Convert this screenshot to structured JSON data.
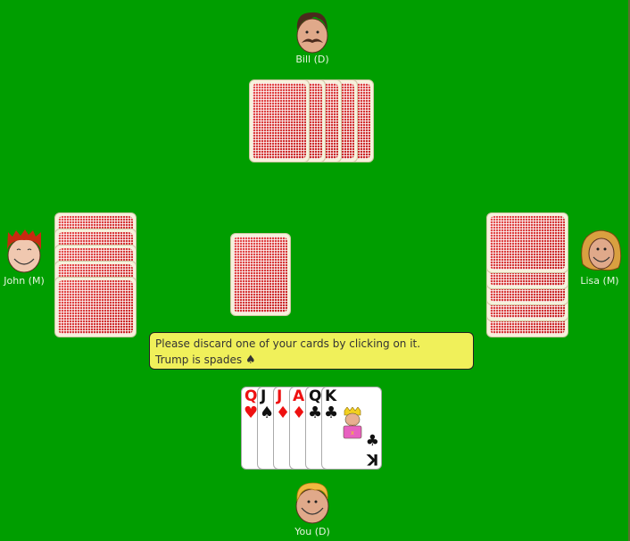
{
  "game": {
    "message_line1": "Please discard one of your cards by clicking on it.",
    "message_line2": "Trump is spades",
    "trump_suit_icon": "♠",
    "trump_suit": "spades"
  },
  "players": {
    "top": {
      "name": "Bill (D)",
      "card_count": 5
    },
    "left": {
      "name": "John (M)",
      "card_count": 5
    },
    "right": {
      "name": "Lisa (M)",
      "card_count": 5
    },
    "bottom": {
      "name": "You (D)",
      "card_count": 6
    }
  },
  "center": {
    "face_down_cards": 1
  },
  "hand": [
    {
      "rank": "Q",
      "suit": "♥",
      "suit_name": "hearts",
      "color": "red"
    },
    {
      "rank": "J",
      "suit": "♠",
      "suit_name": "spades",
      "color": "black"
    },
    {
      "rank": "J",
      "suit": "♦",
      "suit_name": "diamonds",
      "color": "red"
    },
    {
      "rank": "A",
      "suit": "♦",
      "suit_name": "diamonds",
      "color": "red"
    },
    {
      "rank": "Q",
      "suit": "♣",
      "suit_name": "clubs",
      "color": "black"
    },
    {
      "rank": "K",
      "suit": "♣",
      "suit_name": "clubs",
      "color": "black"
    }
  ],
  "colors": {
    "table": "#009e00",
    "message_bg": "#f0f05a",
    "card_back": "#e23232"
  }
}
